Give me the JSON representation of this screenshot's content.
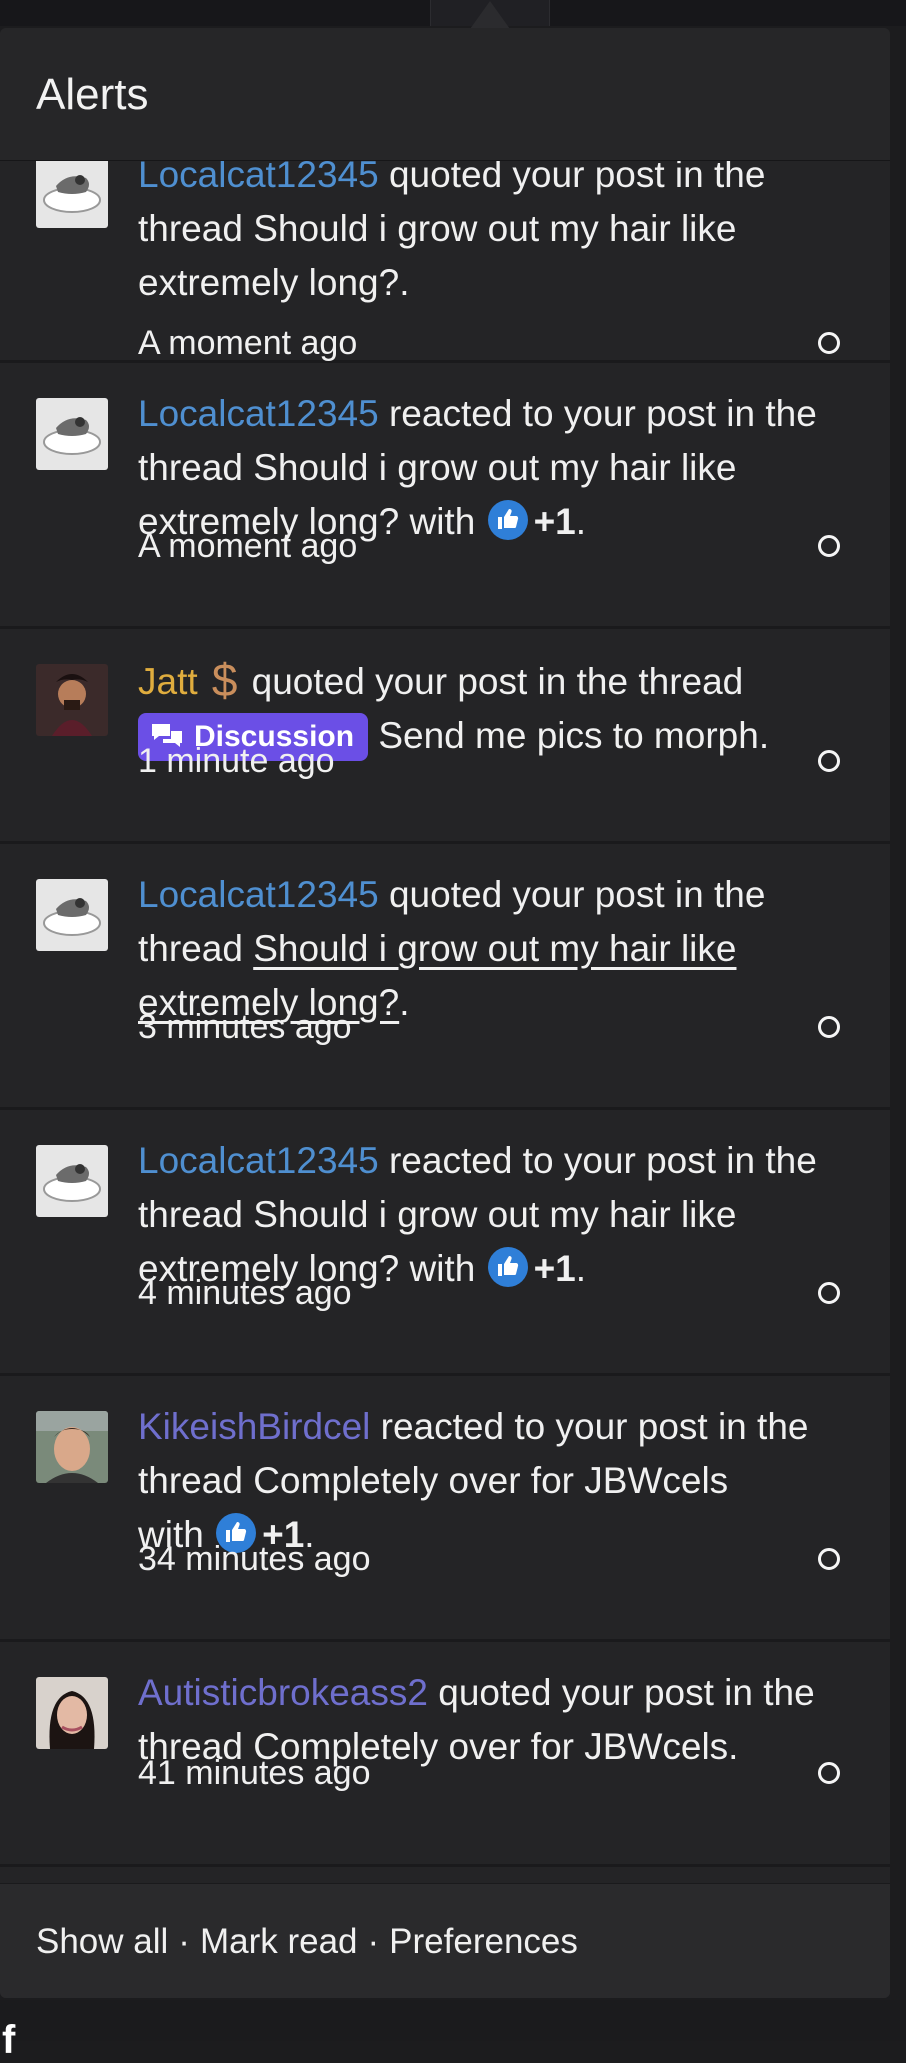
{
  "panel": {
    "title": "Alerts"
  },
  "alerts": [
    {
      "user": "Localcat12345",
      "action": "quoted your post in the thread",
      "thread": "Should i grow out my hair like extremely long?",
      "time": "A moment ago"
    },
    {
      "user": "Localcat12345",
      "action": "reacted to your post in the thread",
      "thread": "Should i grow out my hair like extremely long?",
      "with": "with",
      "reaction": "+1",
      "time": "A moment ago"
    },
    {
      "user": "Jatt",
      "action": "quoted your post in the thread",
      "prefix": "Discussion",
      "thread": "Send me pics to morph",
      "time": "1 minute ago"
    },
    {
      "user": "Localcat12345",
      "action": "quoted your post in the",
      "action2": "thread",
      "thread": "Should i grow out my hair like extremely long?",
      "time": "3 minutes ago"
    },
    {
      "user": "Localcat12345",
      "action": "reacted to your post in the thread",
      "thread": "Should i grow out my hair like extremely long?",
      "with": "with",
      "reaction": "+1",
      "time": "4 minutes ago"
    },
    {
      "user": "KikeishBirdcel",
      "action": "reacted to your post in the thread",
      "thread": "Completely over for JBWcels",
      "with": "with",
      "reaction": "+1",
      "time": "34 minutes ago"
    },
    {
      "user": "Autisticbrokeass2",
      "action": "quoted your post in the thread",
      "thread": "Completely over for JBWcels",
      "time": "41 minutes ago"
    }
  ],
  "footer": {
    "show_all": "Show all",
    "mark_read": "Mark read",
    "preferences": "Preferences",
    "separator": "·"
  },
  "colors": {
    "username": "#4f8fd0",
    "username_gold": "#e0ad3e",
    "username_purple": "#6f6fcd",
    "badge": "#6b4fe6",
    "reaction": "#2f7fd8"
  },
  "icons": {
    "reaction": "thumbs-up-icon",
    "badge": "chat-bubbles-icon",
    "unread": "unread-dot-icon"
  }
}
